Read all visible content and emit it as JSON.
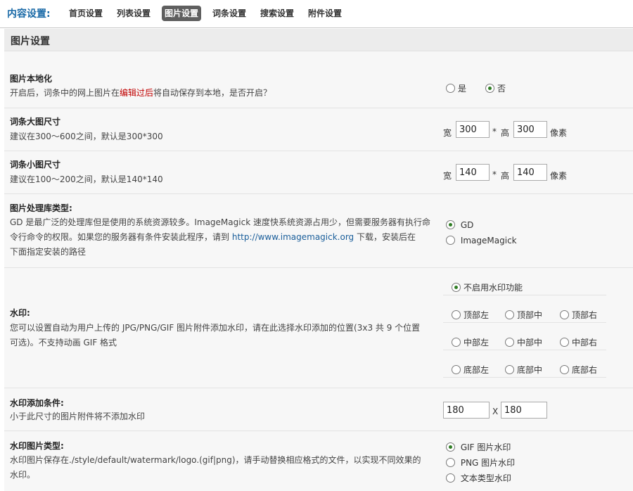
{
  "nav": {
    "label": "内容设置:",
    "tabs": [
      "首页设置",
      "列表设置",
      "图片设置",
      "词条设置",
      "搜索设置",
      "附件设置"
    ],
    "active": "图片设置"
  },
  "section_title": "图片设置",
  "localize": {
    "title": "图片本地化",
    "desc_pre": "开启后，词条中的网上图片在",
    "desc_red": "编辑过后",
    "desc_post": "将自动保存到本地，是否开启？",
    "opt_yes": "是",
    "opt_no": "否",
    "selected": "否"
  },
  "big_size": {
    "title": "词条大图尺寸",
    "desc": "建议在300～600之间，默认是300*300",
    "width_label": "宽",
    "sep": "*",
    "height_label": "高",
    "width": "300",
    "height": "300",
    "unit": "像素"
  },
  "small_size": {
    "title": "词条小图尺寸",
    "desc": "建议在100～200之间，默认是140*140",
    "width_label": "宽",
    "sep": "*",
    "height_label": "高",
    "width": "140",
    "height": "140",
    "unit": "像素"
  },
  "lib": {
    "title": "图片处理库类型:",
    "desc_line1": "GD 是最广泛的处理库但是使用的系统资源较多。ImageMagick 速度快系统资源占用少，但需要服务器有执行命",
    "desc_line2": "令行命令的权限。如果您的服务器有条件安装此程序，请到",
    "desc_link": "http://www.imagemagick.org",
    "desc_line2_post": "下载，安装后在",
    "desc_line3": "下面指定安装的路径",
    "opt_gd": "GD",
    "opt_im": "ImageMagick",
    "selected": "GD"
  },
  "watermark": {
    "title": "水印:",
    "desc_line1": "您可以设置自动为用户上传的 JPG/PNG/GIF 图片附件添加水印，请在此选择水印添加的位置(3x3 共 9 个位置",
    "desc_line2": "可选)。不支持动画 GIF 格式",
    "disable": "不启用水印功能",
    "positions": [
      [
        "顶部左",
        "顶部中",
        "顶部右"
      ],
      [
        "中部左",
        "中部中",
        "中部右"
      ],
      [
        "底部左",
        "底部中",
        "底部右"
      ]
    ],
    "selected": "不启用水印功能"
  },
  "condition": {
    "title": "水印添加条件:",
    "desc": "小于此尺寸的图片附件将不添加水印",
    "width": "180",
    "sep": "X",
    "height": "180"
  },
  "wmtype": {
    "title": "水印图片类型:",
    "desc_line1": "水印图片保存在./style/default/watermark/logo.(gif|png)，请手动替换相应格式的文件，以实现不同效果的",
    "desc_line2": "水印。",
    "opt_gif": "GIF 图片水印",
    "opt_png": "PNG 图片水印",
    "opt_text": "文本类型水印",
    "selected": "GIF 图片水印"
  },
  "colors": {
    "nav_label": "#1a6aa7",
    "active_tab": "#5f5f5f",
    "highlight": "#c00000",
    "link": "#1a5e9a"
  }
}
